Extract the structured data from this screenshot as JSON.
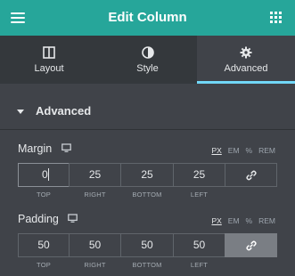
{
  "header": {
    "title": "Edit Column",
    "menu_icon": "hamburger-icon",
    "apps_icon": "grid-icon"
  },
  "tabs": [
    {
      "label": "Layout",
      "icon": "layout-icon",
      "active": false
    },
    {
      "label": "Style",
      "icon": "contrast-icon",
      "active": false
    },
    {
      "label": "Advanced",
      "icon": "gear-icon",
      "active": true
    }
  ],
  "section": {
    "title": "Advanced",
    "expanded": true
  },
  "margin": {
    "label": "Margin",
    "units": [
      "PX",
      "EM",
      "%",
      "REM"
    ],
    "selected_unit": "PX",
    "values": {
      "top": "0",
      "right": "25",
      "bottom": "25",
      "left": "25"
    },
    "captions": {
      "top": "TOP",
      "right": "RIGHT",
      "bottom": "BOTTOM",
      "left": "LEFT"
    },
    "linked": false
  },
  "padding": {
    "label": "Padding",
    "units": [
      "PX",
      "EM",
      "%",
      "REM"
    ],
    "selected_unit": "PX",
    "values": {
      "top": "50",
      "right": "50",
      "bottom": "50",
      "left": "50"
    },
    "captions": {
      "top": "TOP",
      "right": "RIGHT",
      "bottom": "BOTTOM",
      "left": "LEFT"
    },
    "linked": true
  },
  "colors": {
    "header": "#26a69a",
    "panel": "#404349",
    "tabbar": "#34383c",
    "active_underline": "#71d7f7"
  }
}
